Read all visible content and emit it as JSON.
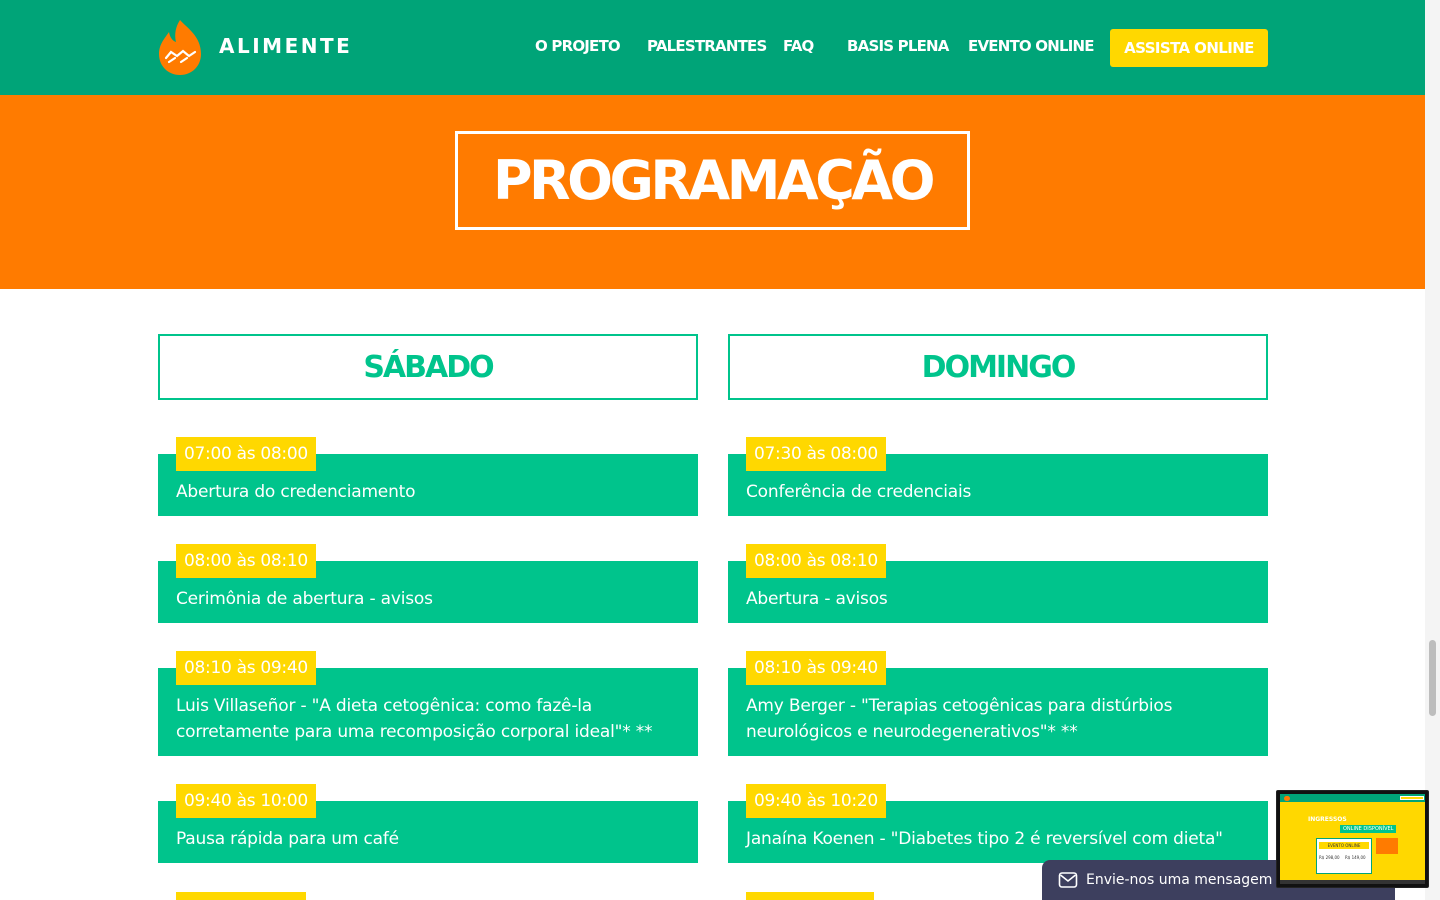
{
  "header": {
    "brand": "ALIMENTE",
    "nav": [
      "O PROJETO",
      "PALESTRANTES",
      "FAQ",
      "BASIS PLENA",
      "EVENTO ONLINE"
    ],
    "cta_label": "ASSISTA ONLINE"
  },
  "hero": {
    "title": "PROGRAMAÇÃO"
  },
  "saturday": {
    "title": "SÁBADO",
    "items": [
      {
        "time": "07:00 às 08:00",
        "text": "Abertura do credenciamento"
      },
      {
        "time": "08:00 às 08:10",
        "text": "Cerimônia de abertura - avisos"
      },
      {
        "time": "08:10 às 09:40",
        "text": "Luis Villaseñor - \"A dieta cetogênica: como fazê-la corretamente para uma recomposição corporal ideal\"* **"
      },
      {
        "time": "09:40 às 10:00",
        "text": "Pausa rápida para um café"
      }
    ]
  },
  "sunday": {
    "title": "DOMINGO",
    "items": [
      {
        "time": "07:30 às 08:00",
        "text": "Conferência de credenciais"
      },
      {
        "time": "08:00 às 08:10",
        "text": "Abertura - avisos"
      },
      {
        "time": "08:10 às 09:40",
        "text": "Amy Berger - \"Terapias cetogênicas para distúrbios neurológicos e neurodegenerativos\"* **"
      },
      {
        "time": "09:40 às 10:20",
        "text": "Janaína Koenen - \"Diabetes tipo 2 é reversível com dieta\""
      }
    ]
  },
  "chat": {
    "label": "Envie-nos uma mensagem"
  },
  "preview": {
    "heading": "INGRESSOS",
    "subheading": "ONLINE DISPONÍVEL",
    "card_label": "EVENTO ONLINE",
    "price_1": "R$ 298,00",
    "price_2": "R$ 149,00"
  },
  "colors": {
    "header_green": "#00a478",
    "accent_green": "#00c48c",
    "orange": "#ff7b00",
    "yellow": "#ffd800"
  }
}
